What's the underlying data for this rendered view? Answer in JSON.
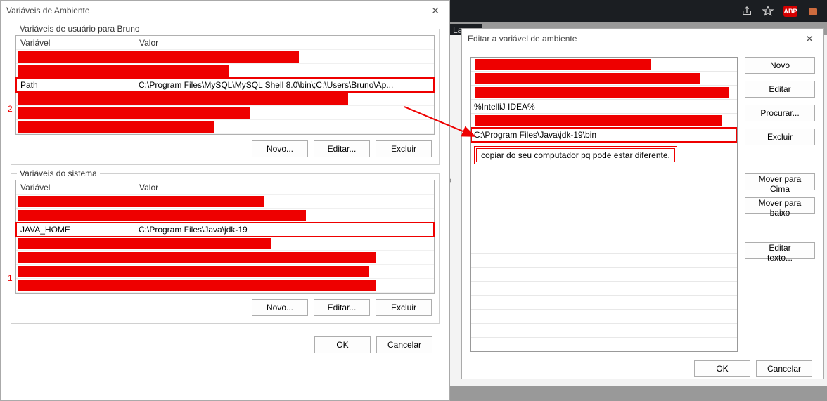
{
  "browser": {
    "languages_tab": "Langu",
    "abp": "ABP"
  },
  "env_dialog": {
    "title": "Variáveis de Ambiente",
    "user_group_label": "Variáveis de usuário para Bruno",
    "system_group_label": "Variáveis do sistema",
    "col_variable": "Variável",
    "col_value": "Valor",
    "user_rows": {
      "path_name": "Path",
      "path_value": "C:\\Program Files\\MySQL\\MySQL Shell 8.0\\bin\\;C:\\Users\\Bruno\\Ap..."
    },
    "system_rows": {
      "java_home_name": "JAVA_HOME",
      "java_home_value": "C:\\Program Files\\Java\\jdk-19"
    },
    "btn_new": "Novo...",
    "btn_edit": "Editar...",
    "btn_delete": "Excluir",
    "btn_ok": "OK",
    "btn_cancel": "Cancelar",
    "annotation_1": "1",
    "annotation_2": "2"
  },
  "edit_dialog": {
    "title": "Editar a variável de ambiente",
    "rows": {
      "intellij": "%IntelliJ IDEA%",
      "jdk_bin": "C:\\Program Files\\Java\\jdk-19\\bin",
      "tip": "copiar do seu computador pq pode estar diferente."
    },
    "btn_new": "Novo",
    "btn_edit": "Editar",
    "btn_browse": "Procurar...",
    "btn_delete": "Excluir",
    "btn_move_up": "Mover para Cima",
    "btn_move_down": "Mover para baixo",
    "btn_edit_text": "Editar texto...",
    "btn_ok": "OK",
    "btn_cancel": "Cancelar"
  }
}
